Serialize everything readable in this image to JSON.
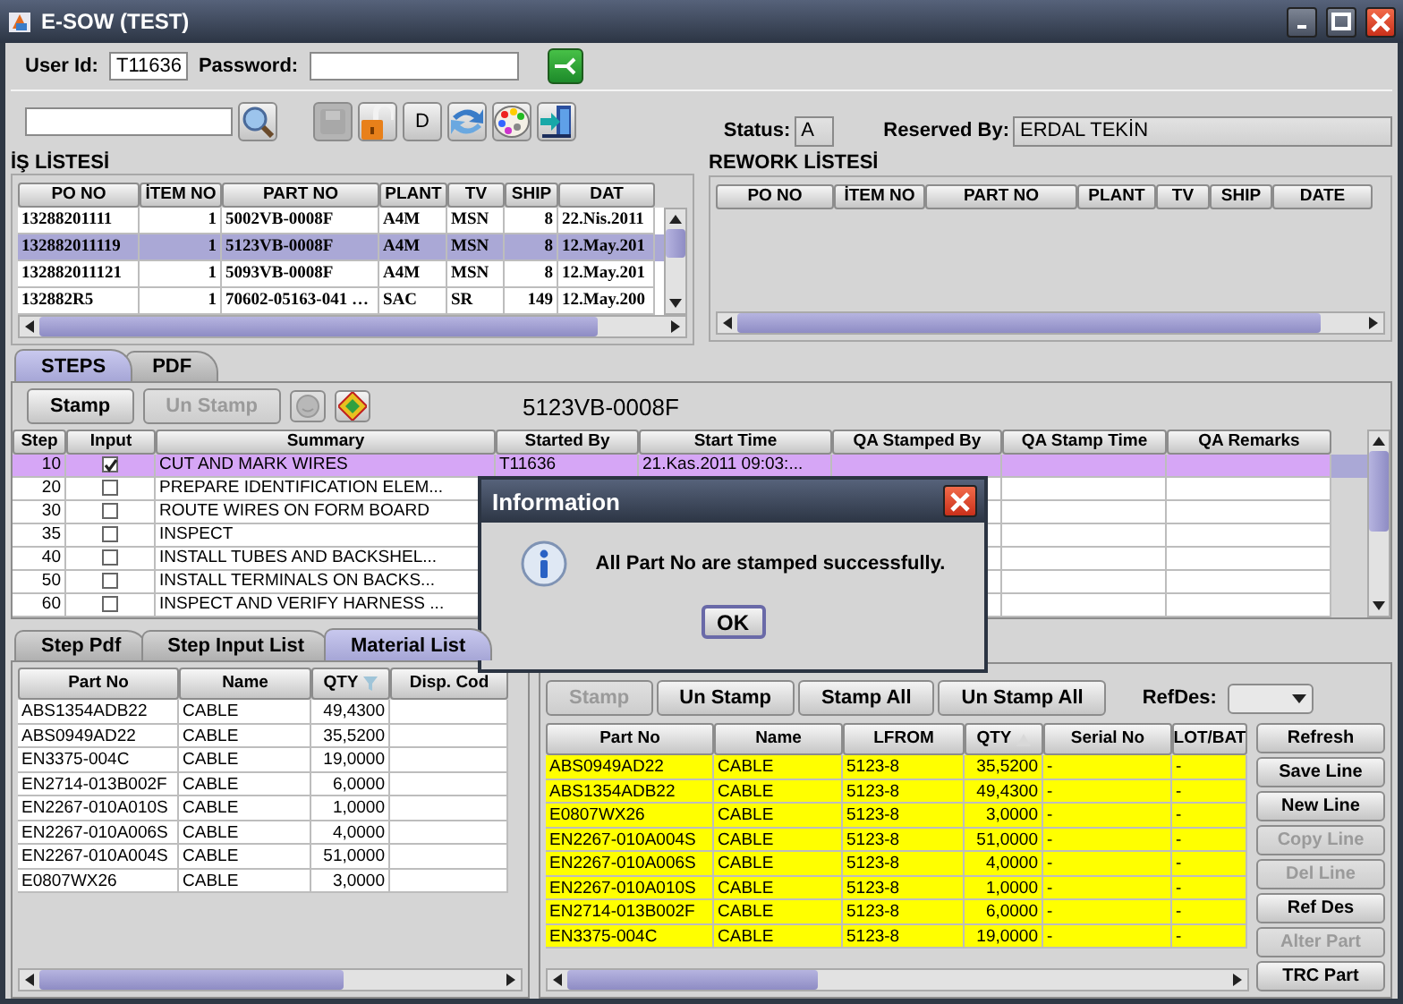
{
  "window": {
    "title": "E-SOW (TEST)"
  },
  "login": {
    "user_id_label": "User Id:",
    "user_id": "T11636",
    "password_label": "Password:"
  },
  "toolbar": {
    "buttons": [
      {
        "kind": "disk",
        "disabled": true
      },
      {
        "kind": "lock",
        "disabled": false
      },
      {
        "kind": "text",
        "label": "D",
        "disabled": false
      },
      {
        "kind": "refresh",
        "disabled": false
      },
      {
        "kind": "palette",
        "disabled": false
      },
      {
        "kind": "exit",
        "disabled": false
      }
    ]
  },
  "status": {
    "label": "Status:",
    "value": "A"
  },
  "reserved_by": {
    "label": "Reserved By:",
    "value": "ERDAL TEKİN"
  },
  "job_list": {
    "title": "İŞ LİSTESİ",
    "columns": [
      "PO NO",
      "İTEM NO",
      "PART NO",
      "PLANT",
      "TV",
      "SHIP",
      "DAT"
    ],
    "rows": [
      {
        "cells": [
          "13288201111",
          "1",
          "5002VB-0008F",
          "A4M",
          "MSN",
          "8",
          "22.Nis.2011"
        ],
        "selected": false
      },
      {
        "cells": [
          "132882011119",
          "1",
          "5123VB-0008F",
          "A4M",
          "MSN",
          "8",
          "12.May.201"
        ],
        "selected": true
      },
      {
        "cells": [
          "132882011121",
          "1",
          "5093VB-0008F",
          "A4M",
          "MSN",
          "8",
          "12.May.201"
        ],
        "selected": false
      },
      {
        "cells": [
          "132882R5",
          "1",
          "70602-05163-041 …",
          "SAC",
          "SR",
          "149",
          "12.May.200"
        ],
        "selected": false
      }
    ]
  },
  "rework_list": {
    "title": "REWORK LİSTESİ",
    "columns": [
      "PO NO",
      "İTEM NO",
      "PART NO",
      "PLANT",
      "TV",
      "SHIP",
      "DATE"
    ]
  },
  "main_tabs": [
    {
      "label": "STEPS",
      "selected": true
    },
    {
      "label": "PDF",
      "selected": false
    }
  ],
  "steps": {
    "buttons": [
      {
        "kind": "text",
        "label": "Stamp",
        "disabled": false
      },
      {
        "kind": "text",
        "label": "Un Stamp",
        "disabled": true
      },
      {
        "kind": "face",
        "disabled": true
      },
      {
        "kind": "diamond",
        "disabled": false
      }
    ],
    "part_no": "5123VB-0008F",
    "columns": [
      "Step",
      "Input",
      "Summary",
      "Started By",
      "Start Time",
      "QA Stamped By",
      "QA Stamp Time",
      "QA Remarks"
    ],
    "rows": [
      {
        "step": "10",
        "input": true,
        "summary": "CUT AND MARK WIRES",
        "started_by": "T11636",
        "start_time": "21.Kas.2011 09:03:...",
        "selected": true
      },
      {
        "step": "20",
        "input": false,
        "summary": "PREPARE IDENTIFICATION ELEM...",
        "selected": false
      },
      {
        "step": "30",
        "input": false,
        "summary": "ROUTE WIRES ON FORM BOARD",
        "selected": false
      },
      {
        "step": "35",
        "input": false,
        "summary": "INSPECT",
        "selected": false
      },
      {
        "step": "40",
        "input": false,
        "summary": "INSTALL TUBES AND BACKSHEL...",
        "selected": false
      },
      {
        "step": "50",
        "input": false,
        "summary": "INSTALL TERMINALS ON BACKS...",
        "selected": false
      },
      {
        "step": "60",
        "input": false,
        "summary": "INSPECT AND VERIFY HARNESS ...",
        "selected": false
      }
    ]
  },
  "sub_tabs": [
    {
      "label": "Step Pdf",
      "selected": false
    },
    {
      "label": "Step Input List",
      "selected": false
    },
    {
      "label": "Material List",
      "selected": true
    }
  ],
  "material_list": {
    "columns": [
      {
        "label": "Part No"
      },
      {
        "label": "Name"
      },
      {
        "label": "QTY",
        "kind": "filtered"
      },
      {
        "label": "Disp. Cod"
      }
    ],
    "rows": [
      [
        "ABS1354ADB22",
        "CABLE",
        "49,4300"
      ],
      [
        "ABS0949AD22",
        "CABLE",
        "35,5200"
      ],
      [
        "EN3375-004C",
        "CABLE",
        "19,0000"
      ],
      [
        "EN2714-013B002F",
        "CABLE",
        "6,0000"
      ],
      [
        "EN2267-010A010S",
        "CABLE",
        "1,0000"
      ],
      [
        "EN2267-010A006S",
        "CABLE",
        "4,0000"
      ],
      [
        "EN2267-010A004S",
        "CABLE",
        "51,0000"
      ],
      [
        "E0807WX26",
        "CABLE",
        "3,0000"
      ]
    ]
  },
  "stamp_panel": {
    "buttons": [
      {
        "label": "Stamp",
        "disabled": true
      },
      {
        "label": "Un Stamp",
        "disabled": false
      },
      {
        "label": "Stamp All",
        "disabled": false
      },
      {
        "label": "Un Stamp All",
        "disabled": false
      }
    ],
    "refdes_label": "RefDes:",
    "columns": [
      {
        "label": "Part No"
      },
      {
        "label": "Name"
      },
      {
        "label": "LFROM"
      },
      {
        "label": "QTY",
        "kind": "sorted"
      },
      {
        "label": "Serial No"
      },
      {
        "label": "LOT/BAT"
      }
    ],
    "rows": [
      {
        "cells": [
          "ABS0949AD22",
          "CABLE",
          "5123-8",
          "35,5200",
          "-",
          "-"
        ],
        "highlighted": true
      },
      {
        "cells": [
          "ABS1354ADB22",
          "CABLE",
          "5123-8",
          "49,4300",
          "-",
          "-"
        ],
        "highlighted": true
      },
      {
        "cells": [
          "E0807WX26",
          "CABLE",
          "5123-8",
          "3,0000",
          "-",
          "-"
        ],
        "highlighted": true
      },
      {
        "cells": [
          "EN2267-010A004S",
          "CABLE",
          "5123-8",
          "51,0000",
          "-",
          "-"
        ],
        "highlighted": true
      },
      {
        "cells": [
          "EN2267-010A006S",
          "CABLE",
          "5123-8",
          "4,0000",
          "-",
          "-"
        ],
        "highlighted": true
      },
      {
        "cells": [
          "EN2267-010A010S",
          "CABLE",
          "5123-8",
          "1,0000",
          "-",
          "-"
        ],
        "highlighted": true
      },
      {
        "cells": [
          "EN2714-013B002F",
          "CABLE",
          "5123-8",
          "6,0000",
          "-",
          "-"
        ],
        "highlighted": true
      },
      {
        "cells": [
          "EN3375-004C",
          "CABLE",
          "5123-8",
          "19,0000",
          "-",
          "-"
        ],
        "highlighted": true
      }
    ],
    "side_buttons": [
      {
        "label": "Refresh",
        "disabled": false
      },
      {
        "label": "Save Line",
        "disabled": false
      },
      {
        "label": "New Line",
        "disabled": false
      },
      {
        "label": "Copy Line",
        "disabled": true
      },
      {
        "label": "Del Line",
        "disabled": true
      },
      {
        "label": "Ref Des",
        "disabled": false
      },
      {
        "label": "Alter Part",
        "disabled": true
      },
      {
        "label": "TRC Part",
        "disabled": false
      }
    ]
  },
  "dialog": {
    "title": "Information",
    "message": "All Part No are stamped successfully.",
    "button": "OK"
  }
}
